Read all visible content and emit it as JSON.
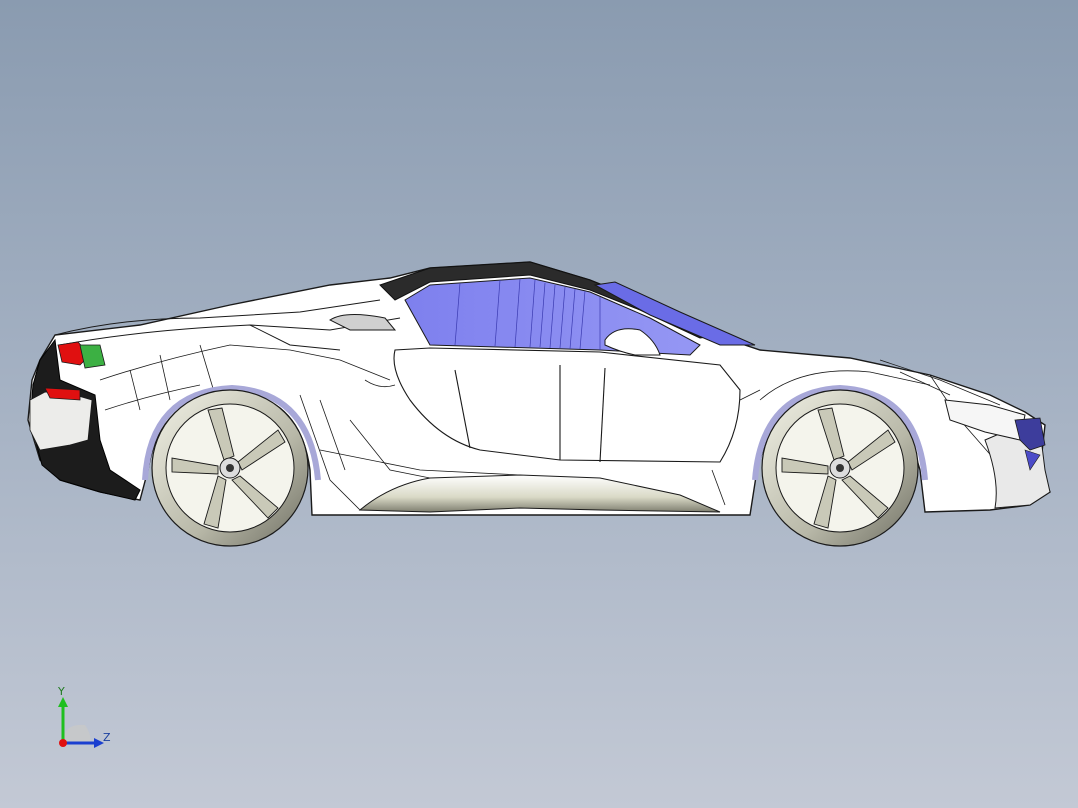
{
  "viewport": {
    "background_top": "#8a9bb0",
    "background_bottom": "#c3c9d5"
  },
  "model": {
    "body_color": "#ffffff",
    "glass_color": "#8a8cf0",
    "roof_color": "#2b2b2b",
    "taillight_color": "#e01010",
    "accent_green": "#3cb043",
    "wheel_color": "#c8c8b8",
    "edge_color": "#1a1a1a"
  },
  "triad": {
    "y_label": "Y",
    "z_label": "Z",
    "y_color": "#1fbf1f",
    "z_color": "#1a3fd0",
    "x_color": "#e01010"
  }
}
